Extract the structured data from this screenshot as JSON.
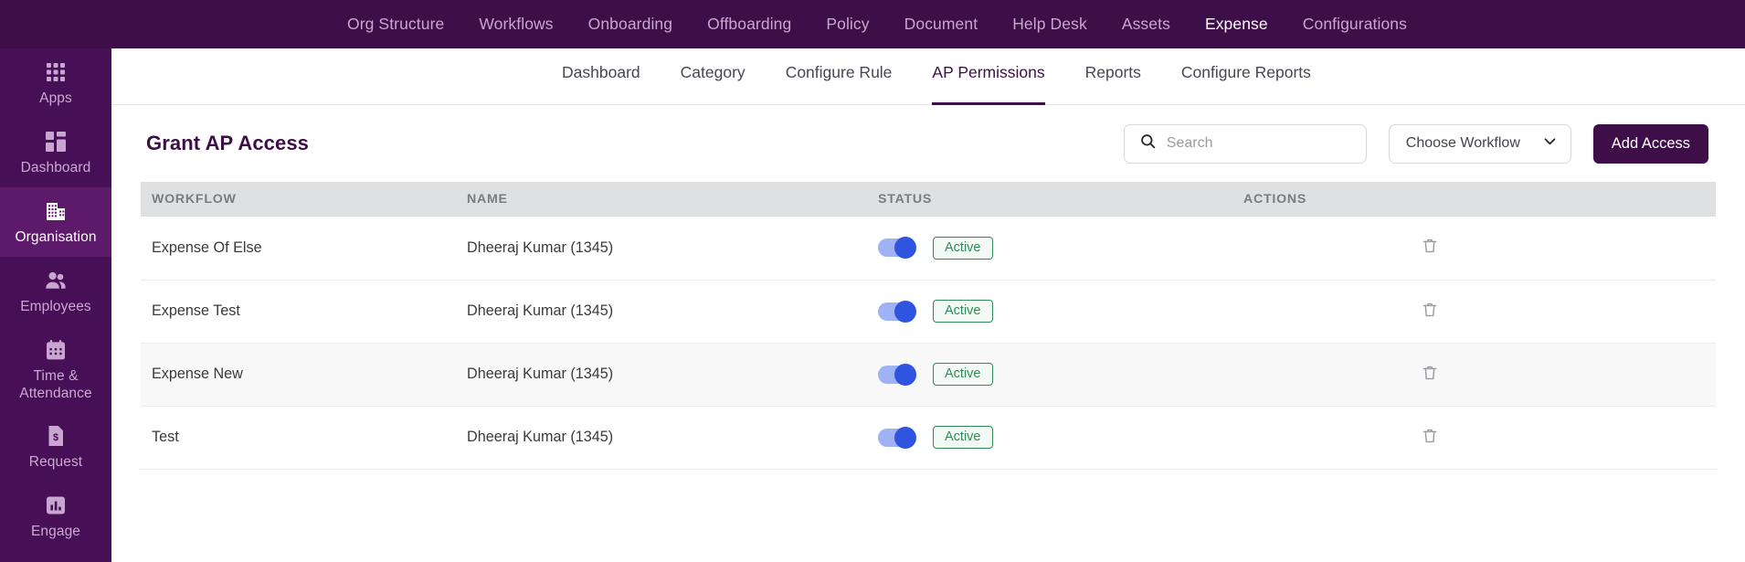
{
  "topnav": {
    "items": [
      {
        "label": "Org Structure",
        "active": false
      },
      {
        "label": "Workflows",
        "active": false
      },
      {
        "label": "Onboarding",
        "active": false
      },
      {
        "label": "Offboarding",
        "active": false
      },
      {
        "label": "Policy",
        "active": false
      },
      {
        "label": "Document",
        "active": false
      },
      {
        "label": "Help Desk",
        "active": false
      },
      {
        "label": "Assets",
        "active": false
      },
      {
        "label": "Expense",
        "active": true
      },
      {
        "label": "Configurations",
        "active": false
      }
    ]
  },
  "sidebar": {
    "items": [
      {
        "label": "Apps",
        "icon": "grid-apps-icon",
        "active": false
      },
      {
        "label": "Dashboard",
        "icon": "dashboard-tiles-icon",
        "active": false
      },
      {
        "label": "Organisation",
        "icon": "building-icon",
        "active": true
      },
      {
        "label": "Employees",
        "icon": "people-icon",
        "active": false
      },
      {
        "label": "Time & Attendance",
        "icon": "calendar-icon",
        "active": false
      },
      {
        "label": "Request",
        "icon": "money-document-icon",
        "active": false
      },
      {
        "label": "Engage",
        "icon": "bar-chart-icon",
        "active": false
      }
    ]
  },
  "subnav": {
    "items": [
      {
        "label": "Dashboard",
        "active": false
      },
      {
        "label": "Category",
        "active": false
      },
      {
        "label": "Configure Rule",
        "active": false
      },
      {
        "label": "AP Permissions",
        "active": true
      },
      {
        "label": "Reports",
        "active": false
      },
      {
        "label": "Configure Reports",
        "active": false
      }
    ]
  },
  "page": {
    "title": "Grant AP Access"
  },
  "search": {
    "placeholder": "Search",
    "value": ""
  },
  "workflow_select": {
    "label": "Choose Workflow"
  },
  "add_access_button": {
    "label": "Add Access"
  },
  "table": {
    "columns": [
      "WORKFLOW",
      "NAME",
      "STATUS",
      "ACTIONS"
    ],
    "rows": [
      {
        "workflow": "Expense Of Else",
        "name": "Dheeraj Kumar (1345)",
        "toggle_on": true,
        "status": "Active"
      },
      {
        "workflow": "Expense Test",
        "name": "Dheeraj Kumar (1345)",
        "toggle_on": true,
        "status": "Active"
      },
      {
        "workflow": "Expense New",
        "name": "Dheeraj Kumar (1345)",
        "toggle_on": true,
        "status": "Active"
      },
      {
        "workflow": "Test",
        "name": "Dheeraj Kumar (1345)",
        "toggle_on": true,
        "status": "Active"
      }
    ]
  },
  "colors": {
    "brand_purple": "#3d0e47",
    "sidebar_purple": "#470f55",
    "sidebar_active": "#5d1a6b",
    "toggle_blue": "#2f55e0",
    "status_green": "#2e8b57",
    "header_gray": "#dfe0e2"
  }
}
